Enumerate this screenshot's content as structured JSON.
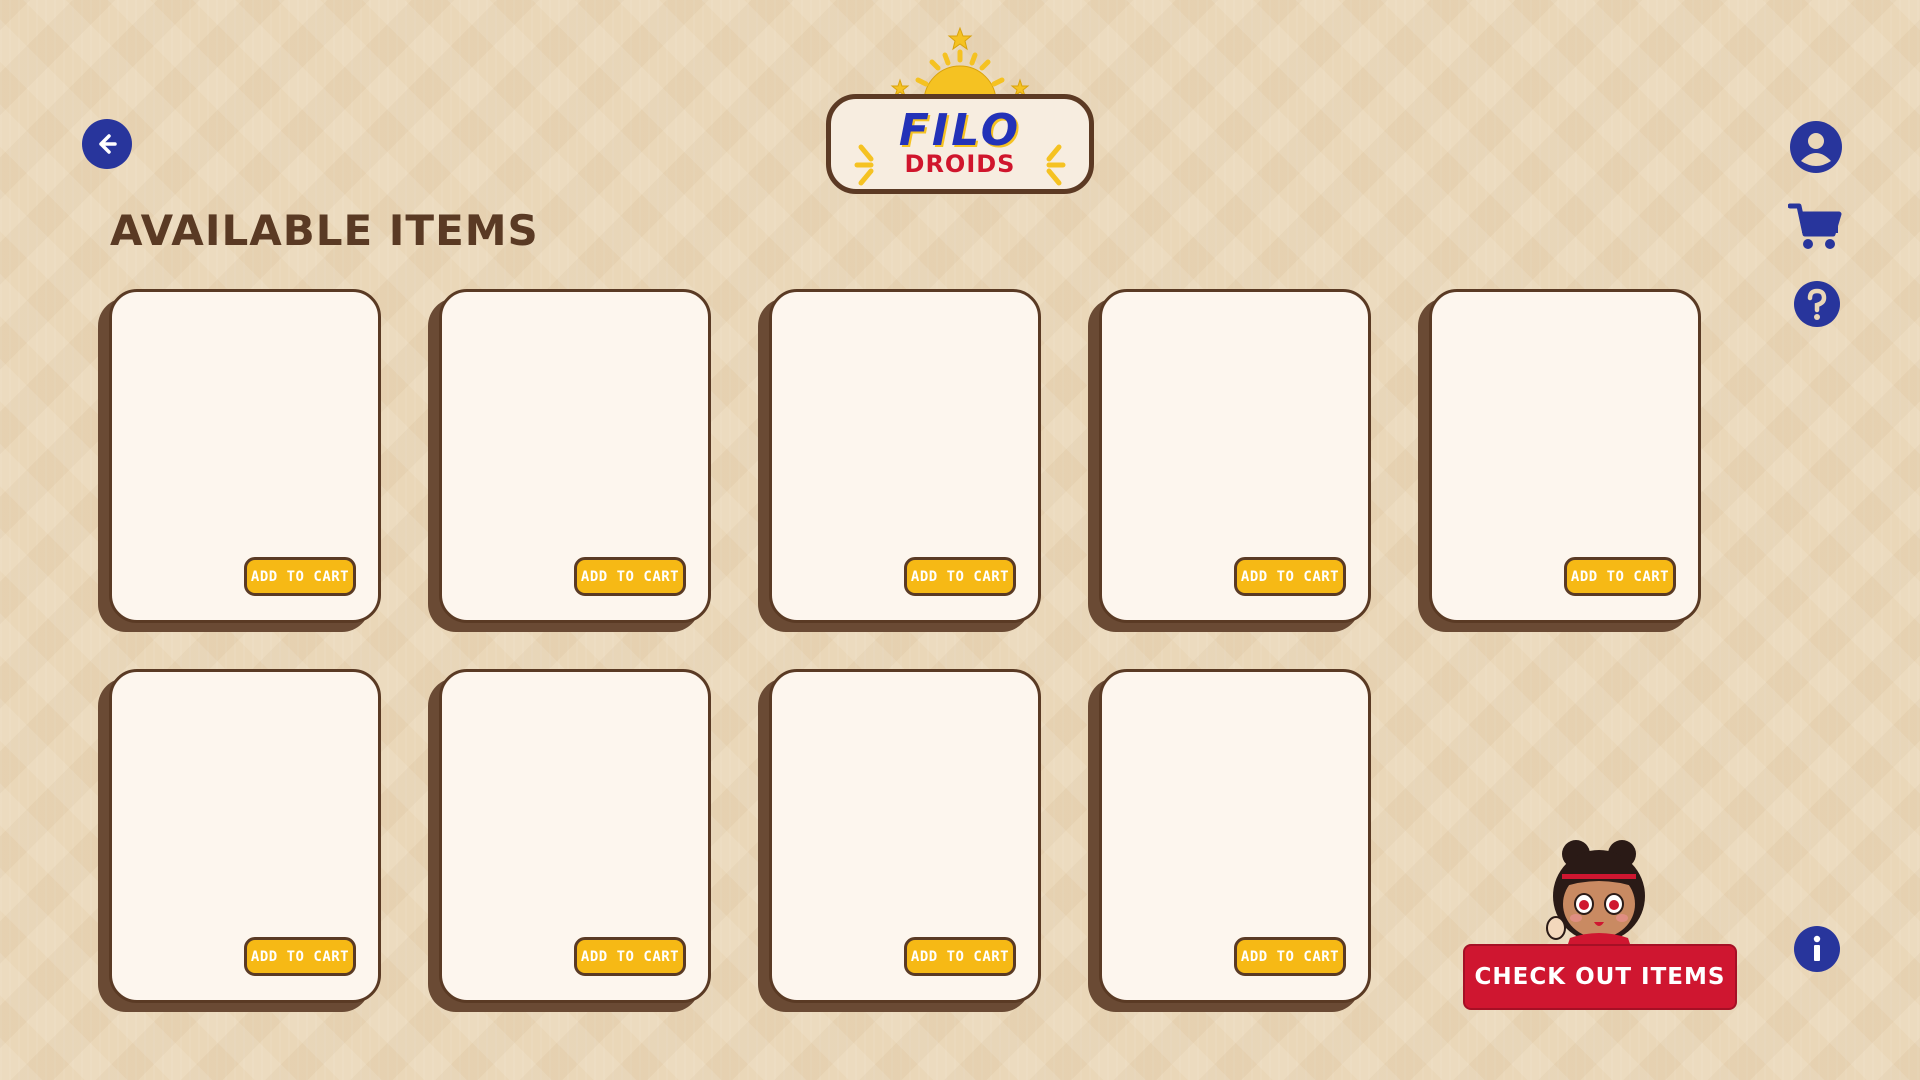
{
  "header": {
    "logo_title": "FILO",
    "logo_subtitle": "DROIDS",
    "back_icon": "arrow-left-icon"
  },
  "main": {
    "title": "AVAILABLE ITEMS",
    "items": [
      {
        "button_label": "ADD TO CART"
      },
      {
        "button_label": "ADD TO CART"
      },
      {
        "button_label": "ADD TO CART"
      },
      {
        "button_label": "ADD TO CART"
      },
      {
        "button_label": "ADD TO CART"
      },
      {
        "button_label": "ADD TO CART"
      },
      {
        "button_label": "ADD TO CART"
      },
      {
        "button_label": "ADD TO CART"
      },
      {
        "button_label": "ADD TO CART"
      }
    ]
  },
  "sidebar": {
    "icons": [
      "user-icon",
      "cart-icon",
      "help-icon",
      "info-icon"
    ]
  },
  "footer": {
    "checkout_label": "CHECK OUT ITEMS"
  },
  "colors": {
    "accent_blue": "#28359c",
    "accent_red": "#cf1630",
    "accent_yellow": "#f6b915",
    "brown": "#5a3a24",
    "card_bg": "#fdf6ee"
  }
}
